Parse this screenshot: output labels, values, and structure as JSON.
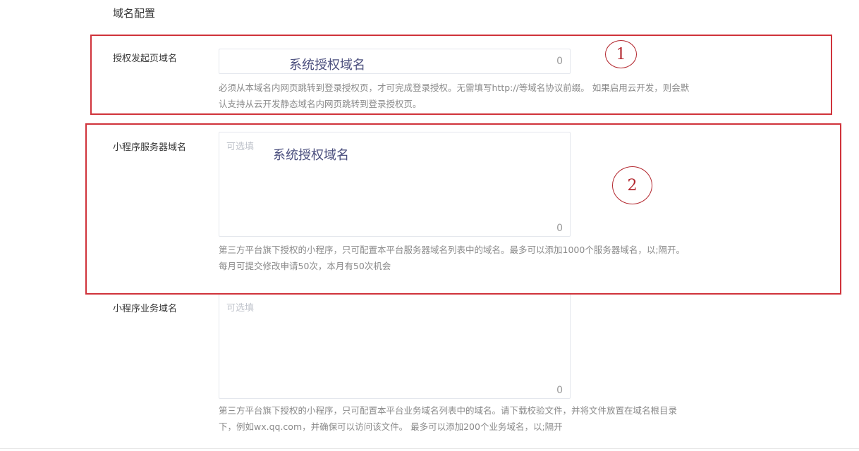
{
  "section_title": "域名配置",
  "fields": [
    {
      "label": "授权发起页域名",
      "value": "",
      "placeholder": "",
      "counter": "0",
      "overlay": "系统授权域名",
      "help": [
        "必须从本域名内网页跳转到登录授权页，才可完成登录授权。无需填写http://等域名协议前缀。 如果启用云开发，则会默",
        "认支持从云开发静态域名内网页跳转到登录授权页。"
      ]
    },
    {
      "label": "小程序服务器域名",
      "value": "",
      "placeholder": "可选填",
      "counter": "0",
      "overlay": "系统授权域名",
      "help": [
        "第三方平台旗下授权的小程序，只可配置本平台服务器域名列表中的域名。最多可以添加1000个服务器域名，以;隔开。",
        "每月可提交修改申请50次，本月有50次机会"
      ]
    },
    {
      "label": "小程序业务域名",
      "value": "",
      "placeholder": "可选填",
      "counter": "0",
      "help": [
        "第三方平台旗下授权的小程序，只可配置本平台业务域名列表中的域名。请下载校验文件，并将文件放置在域名根目录",
        "下，例如wx.qq.com，并确保可以访问该文件。 最多可以添加200个业务域名，以;隔开"
      ]
    }
  ],
  "annotations": [
    "1",
    "2"
  ],
  "colors": {
    "annotation_red": "#d0333b",
    "overlay_text": "#4b4f7e",
    "border": "#e4e7ed"
  }
}
